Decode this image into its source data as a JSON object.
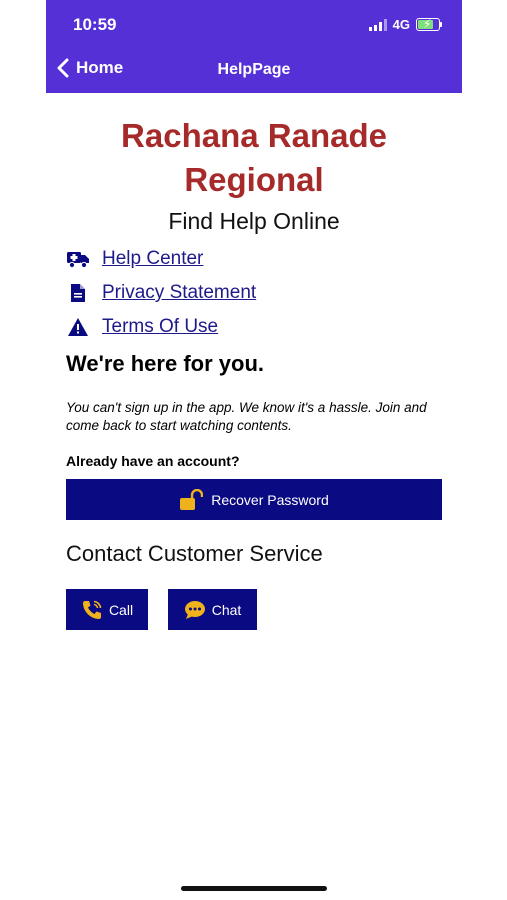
{
  "status_bar": {
    "time": "10:59",
    "network": "4G"
  },
  "nav": {
    "back_label": "Home",
    "title": "HelpPage"
  },
  "brand": {
    "line1": "Rachana Ranade",
    "line2": "Regional"
  },
  "find_help_title": "Find Help Online",
  "links": [
    {
      "label": "Help Center",
      "icon": "ambulance-icon"
    },
    {
      "label": "Privacy Statement",
      "icon": "document-icon"
    },
    {
      "label": "Terms Of Use",
      "icon": "warning-icon"
    }
  ],
  "support_heading": "We're here for you.",
  "signup_note": "You can't sign up in the app. We know it's a hassle. Join and come back to start watching contents.",
  "account_prompt": "Already have an account?",
  "recover_button": "Recover Password",
  "contact_heading": "Contact Customer Service",
  "contact_buttons": {
    "call": "Call",
    "chat": "Chat"
  },
  "colors": {
    "nav_bar": "#5530d6",
    "brand_text": "#a62a2a",
    "button_bg": "#0a0a82",
    "link": "#1e1a8a",
    "icon_gold": "#f0b21c"
  }
}
